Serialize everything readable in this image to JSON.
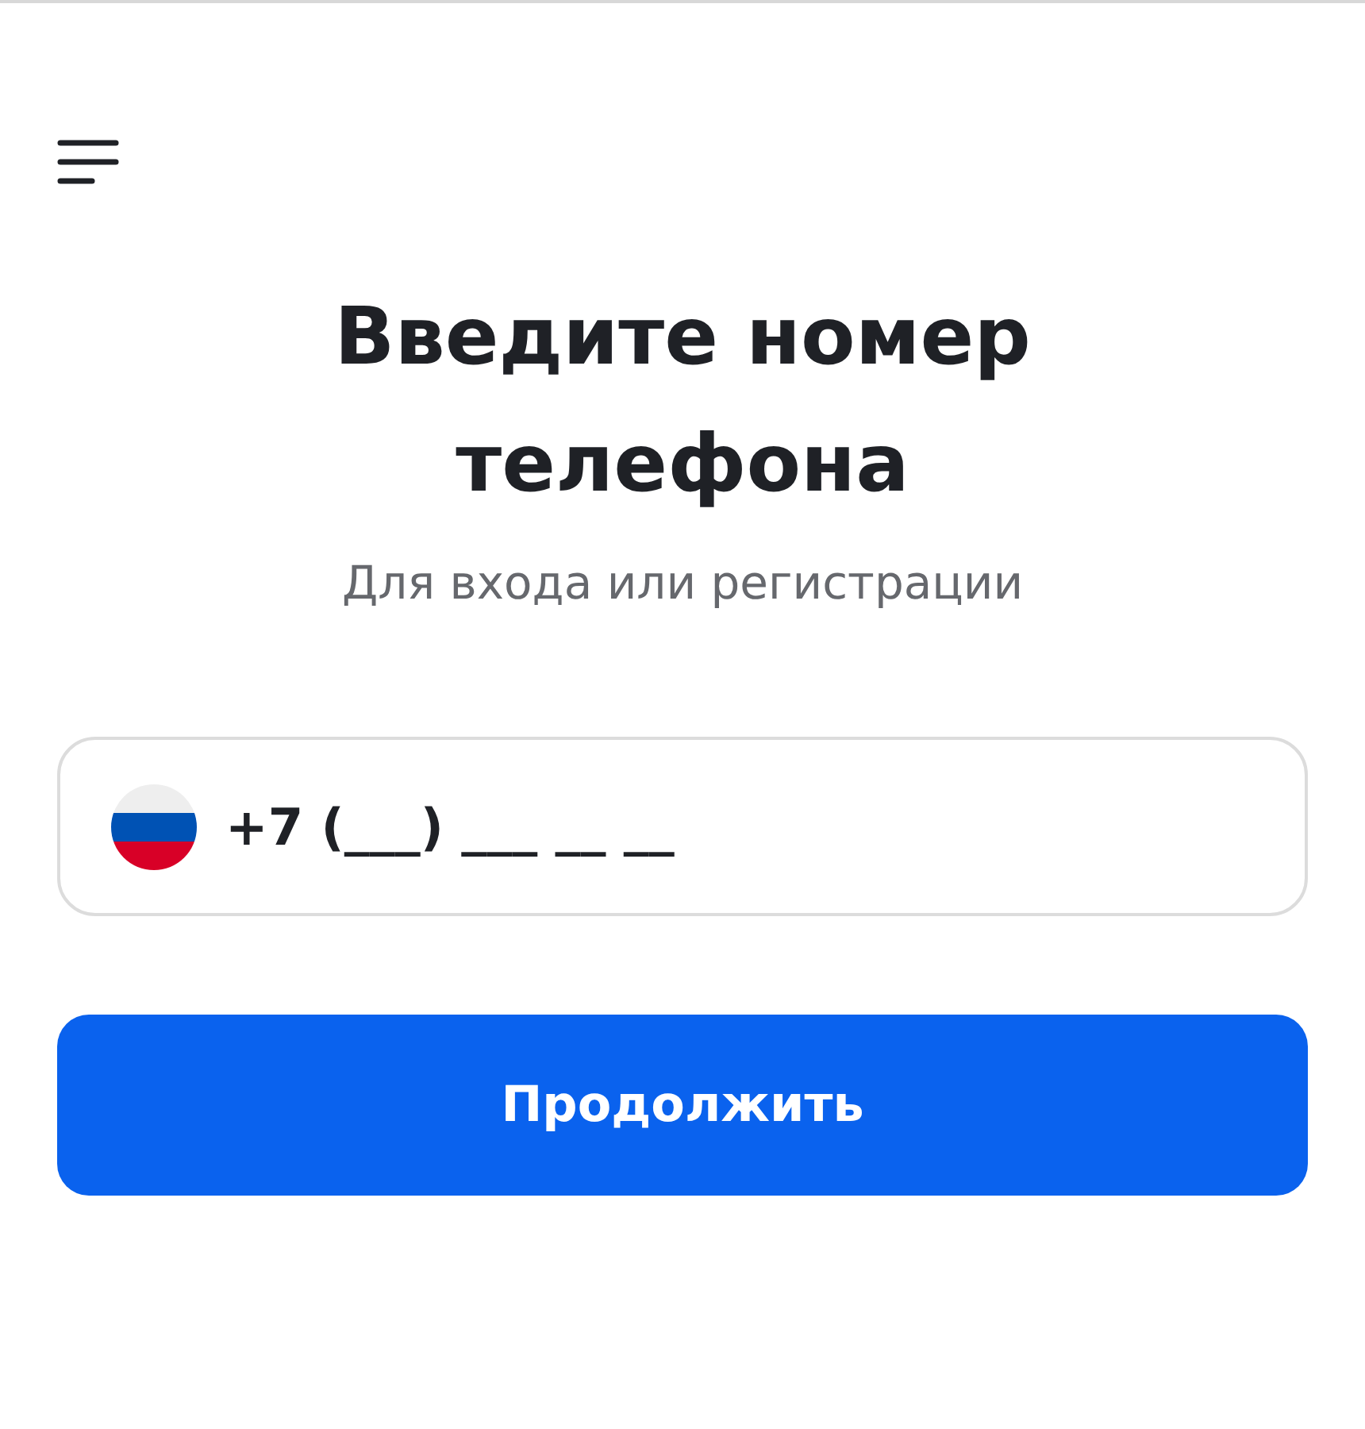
{
  "title": "Введите номер телефона",
  "subtitle": "Для входа или регистрации",
  "phone_field": {
    "placeholder": "+7 (___) ___ __ __"
  },
  "buttons": [
    "Продолжить"
  ]
}
